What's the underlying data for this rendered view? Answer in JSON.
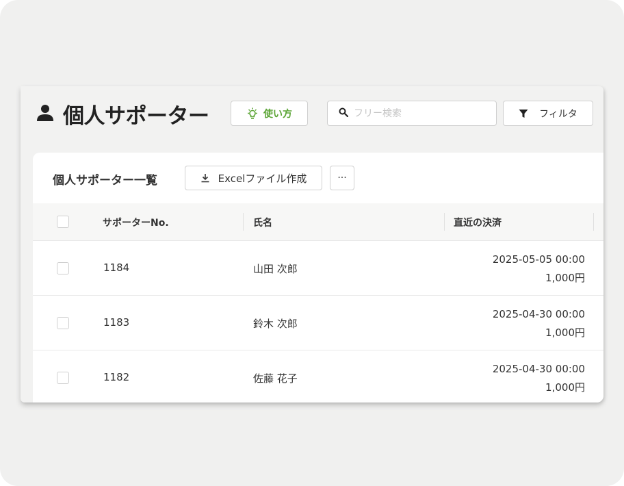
{
  "page": {
    "title": "個人サポーター",
    "howto_label": "使い方",
    "search_placeholder": "フリー検索",
    "filter_label": "フィルタ"
  },
  "list": {
    "title": "個人サポーター一覧",
    "excel_label": "Excelファイル作成",
    "more_label": "···"
  },
  "table": {
    "columns": [
      "サポーターNo.",
      "氏名",
      "直近の決済"
    ],
    "rows": [
      {
        "no": "1184",
        "name": "山田 次郎",
        "date": "2025-05-05 00:00",
        "amount": "1,000円"
      },
      {
        "no": "1183",
        "name": "鈴木 次郎",
        "date": "2025-04-30 00:00",
        "amount": "1,000円"
      },
      {
        "no": "1182",
        "name": "佐藤 花子",
        "date": "2025-04-30 00:00",
        "amount": "1,000円"
      }
    ]
  },
  "colors": {
    "accent_green": "#5aa434",
    "background": "#f0f0ef"
  }
}
